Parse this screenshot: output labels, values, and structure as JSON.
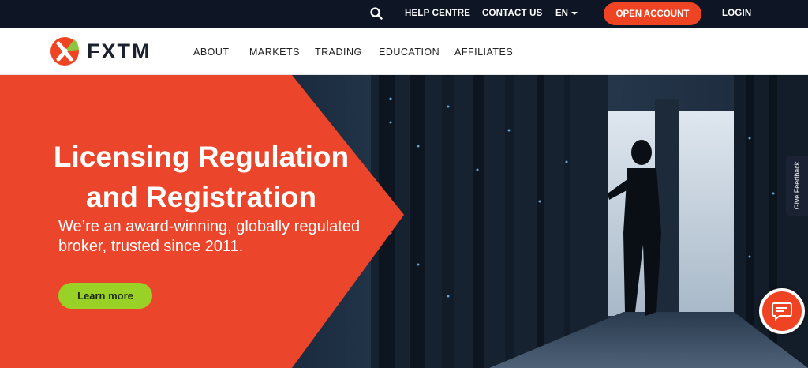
{
  "topbar": {
    "search_icon": "search-icon",
    "help_centre": "HELP CENTRE",
    "contact_us": "CONTACT US",
    "language": "EN",
    "open_account": "OPEN ACCOUNT",
    "login": "LOGIN"
  },
  "nav": {
    "logo_text": "FXTM",
    "items": [
      "ABOUT",
      "MARKETS",
      "TRADING",
      "EDUCATION",
      "AFFILIATES"
    ]
  },
  "hero": {
    "title_line1": "Licensing Regulation",
    "title_line2": "and Registration",
    "subtitle_line1": "We’re an award-winning, globally regulated",
    "subtitle_line2": "broker, trusted since 2011.",
    "cta": "Learn more"
  },
  "feedback_tab": "Give Feedback",
  "chat_icon": "chat-bubble-icon",
  "colors": {
    "topbar_bg": "#0e1524",
    "accent_orange": "#ee4424",
    "cta_green": "#9ad127",
    "logo_green": "#8cc63f"
  }
}
